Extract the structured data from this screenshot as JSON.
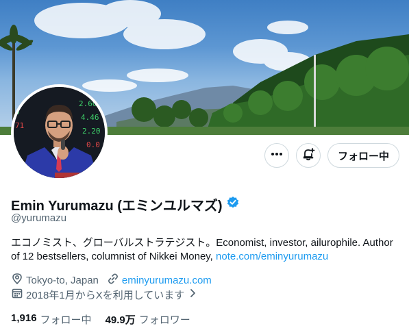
{
  "profile": {
    "display_name": "Emin Yurumazu (エミンユルマズ)",
    "handle": "@yurumazu",
    "verified": true,
    "bio_text": "エコノミスト、グローバルストラテジスト。Economist, investor, ailurophile. Author of 12 bestsellers, columnist of Nikkei Money, ",
    "bio_link": "note.com/eminyurumazu",
    "location": "Tokyo-to, Japan",
    "website": "eminyurumazu.com",
    "joined": "2018年1月からXを利用しています"
  },
  "actions": {
    "more_icon": "more-horizontal-icon",
    "notify_icon": "bell-plus-icon",
    "follow_label": "フォロー中"
  },
  "stats": {
    "following_count": "1,916",
    "following_label": "フォロー中",
    "followers_count": "49.9万",
    "followers_label": "フォロワー"
  },
  "icons": {
    "verified_badge": "verified-badge-icon",
    "location": "location-pin-icon",
    "website": "link-icon",
    "calendar": "calendar-icon",
    "chevron": "chevron-right-icon"
  },
  "colors": {
    "accent": "#1d9bf0",
    "text_primary": "#0f1419",
    "text_secondary": "#536471",
    "border": "#cfd9de"
  }
}
